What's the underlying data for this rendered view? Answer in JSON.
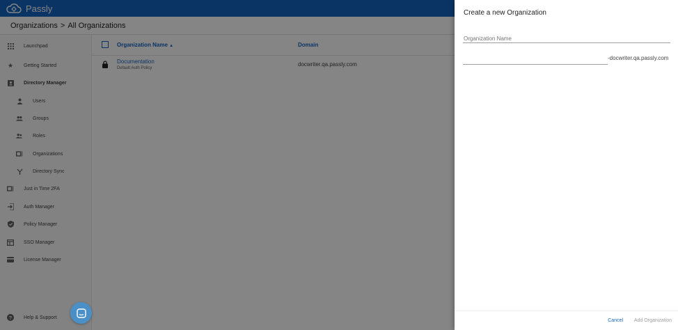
{
  "app": {
    "name": "Passly"
  },
  "breadcrumb": {
    "parent": "Organizations",
    "separator": ">",
    "current": "All Organizations"
  },
  "sidebar": {
    "items": [
      {
        "label": "Launchpad",
        "icon": "grid-icon"
      },
      {
        "label": "Getting Started",
        "icon": "star-icon"
      },
      {
        "label": "Directory Manager",
        "icon": "contact-card-icon"
      },
      {
        "label": "Users",
        "icon": "person-icon"
      },
      {
        "label": "Groups",
        "icon": "group-icon"
      },
      {
        "label": "Roles",
        "icon": "roles-icon"
      },
      {
        "label": "Organizations",
        "icon": "org-card-icon"
      },
      {
        "label": "Directory Sync",
        "icon": "fork-icon"
      },
      {
        "label": "Just in Time 2FA",
        "icon": "badge-icon"
      },
      {
        "label": "Auth Manager",
        "icon": "login-icon"
      },
      {
        "label": "Policy Manager",
        "icon": "shield-icon"
      },
      {
        "label": "SSO Manager",
        "icon": "window-icon"
      },
      {
        "label": "License Manager",
        "icon": "credit-card-icon"
      }
    ],
    "help": {
      "label": "Help & Support",
      "icon": "help-icon"
    }
  },
  "table": {
    "headers": {
      "name": "Organization Name",
      "sort_indicator": "▲",
      "domain": "Domain"
    },
    "rows": [
      {
        "name": "Documentation",
        "subtitle": "Default Auth Policy",
        "domain": "docwriter.qa.passly.com"
      }
    ]
  },
  "drawer": {
    "title": "Create a new Organization",
    "name_field": {
      "label": "Organization Name",
      "value": ""
    },
    "subdomain_field": {
      "value": "",
      "suffix": "-docwriter.qa.passly.com"
    },
    "cancel_label": "Cancel",
    "add_label": "Add Organization"
  },
  "colors": {
    "brand": "#1565c0",
    "chat": "#4a90c7"
  }
}
